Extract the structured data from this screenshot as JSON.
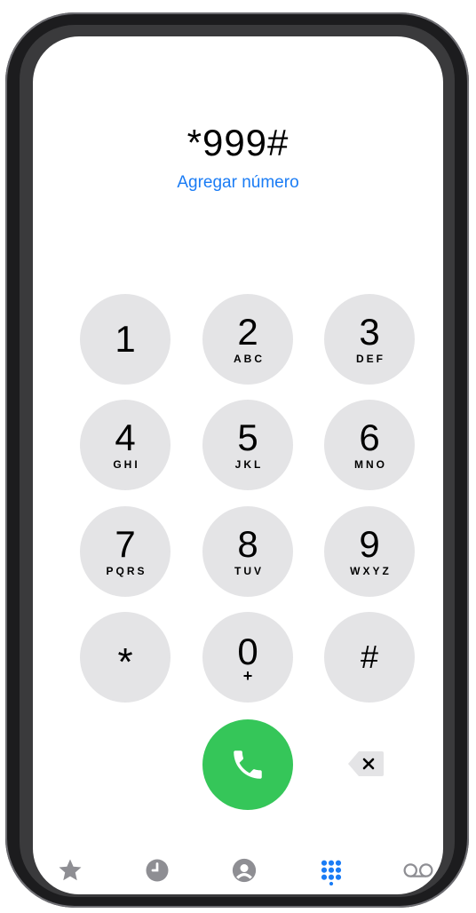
{
  "display": {
    "number": "*999#",
    "add_number": "Agregar número"
  },
  "keypad": [
    {
      "digit": "1",
      "letters": ""
    },
    {
      "digit": "2",
      "letters": "ABC"
    },
    {
      "digit": "3",
      "letters": "DEF"
    },
    {
      "digit": "4",
      "letters": "GHI"
    },
    {
      "digit": "5",
      "letters": "JKL"
    },
    {
      "digit": "6",
      "letters": "MNO"
    },
    {
      "digit": "7",
      "letters": "PQRS"
    },
    {
      "digit": "8",
      "letters": "TUV"
    },
    {
      "digit": "9",
      "letters": "WXYZ"
    },
    {
      "digit": "*",
      "letters": ""
    },
    {
      "digit": "0",
      "letters": "+"
    },
    {
      "digit": "#",
      "letters": ""
    }
  ],
  "tabs": [
    {
      "icon": "star-icon",
      "label": ""
    },
    {
      "icon": "clock-icon",
      "label": ""
    },
    {
      "icon": "contact-icon",
      "label": ""
    },
    {
      "icon": "keypad-icon",
      "label": "",
      "active": true
    },
    {
      "icon": "voicemail-icon",
      "label": ""
    }
  ],
  "colors": {
    "accent": "#1a7cf5",
    "call": "#35c659",
    "key": "#e4e4e6",
    "inactive": "#8e8e93"
  }
}
